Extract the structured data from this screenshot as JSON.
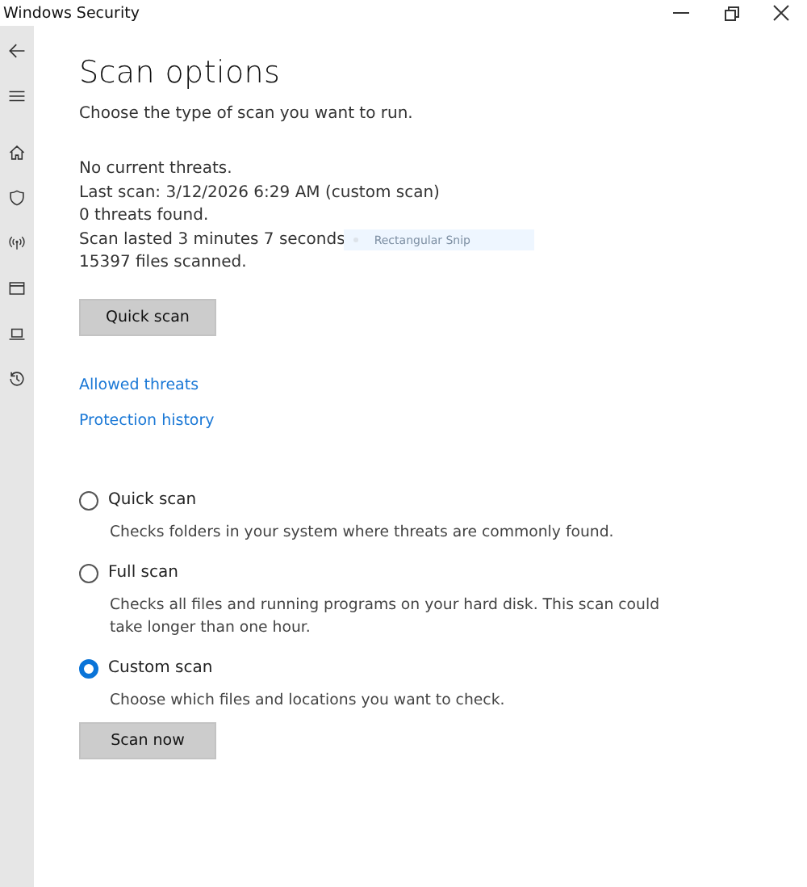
{
  "window": {
    "title": "Windows Security"
  },
  "sidebar": {
    "items": [
      {
        "kind": "back"
      },
      {
        "kind": "menu"
      },
      {
        "kind": "home"
      },
      {
        "kind": "shield"
      },
      {
        "kind": "network"
      },
      {
        "kind": "app"
      },
      {
        "kind": "device"
      },
      {
        "kind": "history"
      }
    ]
  },
  "page": {
    "title": "Scan options",
    "subtitle": "Choose the type of scan you want to run.",
    "status": [
      "No current threats.",
      "Last scan: 3/12/2026 6:29 AM (custom scan)",
      "0 threats found.",
      "Scan lasted 3 minutes 7 seconds",
      "15397 files scanned."
    ],
    "snip_overlay": "Rectangular Snip",
    "quick_button": "Quick scan",
    "links": [
      "Allowed threats",
      "Protection history"
    ],
    "options": [
      {
        "label": "Quick scan",
        "description": "Checks folders in your system where threats are commonly found.",
        "selected": false
      },
      {
        "label": "Full scan",
        "description": "Checks all files and running programs on your hard disk. This scan could take longer than one hour.",
        "selected": false
      },
      {
        "label": "Custom scan",
        "description": "Choose which files and locations you want to check.",
        "selected": true
      }
    ],
    "scan_button": "Scan now"
  }
}
